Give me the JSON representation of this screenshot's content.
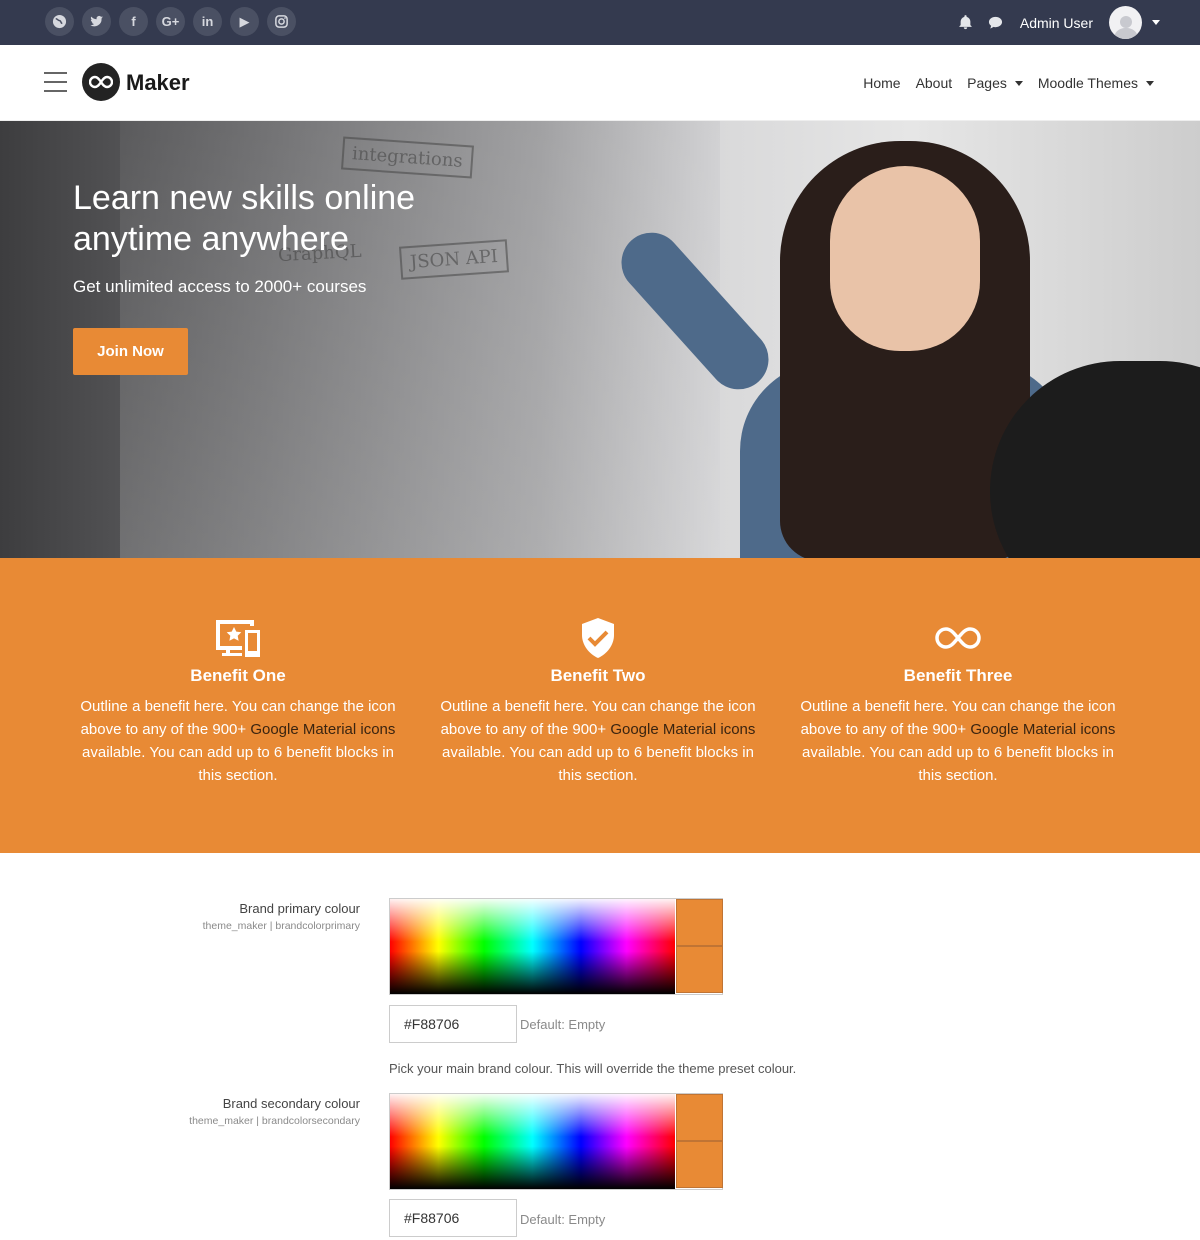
{
  "topbar": {
    "social": [
      {
        "name": "globe-icon",
        "glyph": ""
      },
      {
        "name": "twitter-icon",
        "glyph": ""
      },
      {
        "name": "facebook-icon",
        "glyph": "f"
      },
      {
        "name": "google-plus-icon",
        "glyph": "G+"
      },
      {
        "name": "linkedin-icon",
        "glyph": "in"
      },
      {
        "name": "youtube-icon",
        "glyph": "▶"
      },
      {
        "name": "instagram-icon",
        "glyph": ""
      }
    ],
    "username": "Admin User"
  },
  "navbar": {
    "brand": "Maker",
    "links": [
      "Home",
      "About",
      "Pages",
      "Moodle Themes"
    ]
  },
  "hero": {
    "title": "Learn new skills online anytime anywhere",
    "subtitle": "Get unlimited access to 2000+ courses",
    "cta": "Join Now",
    "sketch_words": [
      "integrations",
      "GraphQL",
      "JSON API"
    ]
  },
  "benefits": [
    {
      "icon": "devices-icon",
      "title": "Benefit One",
      "text_before": "Outline a benefit here. You can change the icon above to any of the 900+ ",
      "link": "Google Material icons",
      "text_after": " available. You can add up to 6 benefit blocks in this section."
    },
    {
      "icon": "verified-shield-icon",
      "title": "Benefit Two",
      "text_before": "Outline a benefit here. You can change the icon above to any of the 900+ ",
      "link": "Google Material icons",
      "text_after": " available. You can add up to 6 benefit blocks in this section."
    },
    {
      "icon": "infinity-icon",
      "title": "Benefit Three",
      "text_before": "Outline a benefit here. You can change the icon above to any of the 900+ ",
      "link": "Google Material icons",
      "text_after": " available. You can add up to 6 benefit blocks in this section."
    }
  ],
  "settings": {
    "primary": {
      "label": "Brand primary colour",
      "key": "theme_maker | brandcolorprimary",
      "value": "#F88706",
      "default": "Default: Empty",
      "description": "Pick your main brand colour. This will override the theme preset colour."
    },
    "secondary": {
      "label": "Brand secondary colour",
      "key": "theme_maker | brandcolorsecondary",
      "value": "#F88706",
      "default": "Default: Empty"
    }
  },
  "colors": {
    "accent": "#e88a35",
    "topbar": "#343a4f"
  }
}
